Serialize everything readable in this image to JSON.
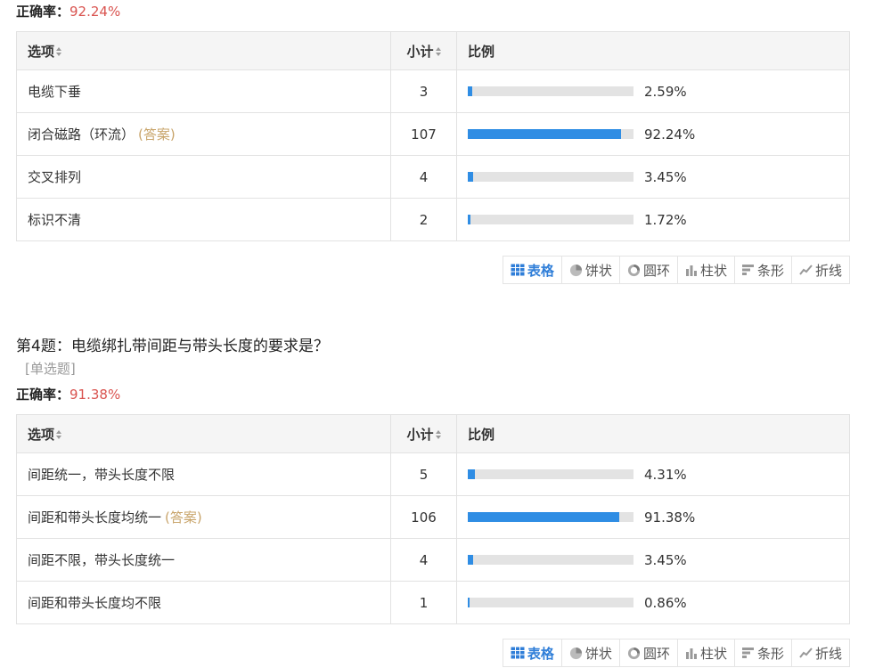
{
  "colors": {
    "accent": "#2f8de4",
    "track": "#e3e3e3",
    "accuracy": "#d9534f",
    "answer_tag": "#c8a46a"
  },
  "headers": {
    "option": "选项",
    "count": "小计",
    "ratio": "比例"
  },
  "answer_tag": "(答案)",
  "tabs": [
    {
      "label": "表格",
      "icon": "table-icon",
      "active": true
    },
    {
      "label": "饼状",
      "icon": "pie-icon",
      "active": false
    },
    {
      "label": "圆环",
      "icon": "ring-icon",
      "active": false
    },
    {
      "label": "柱状",
      "icon": "column-icon",
      "active": false
    },
    {
      "label": "条形",
      "icon": "bar-icon",
      "active": false
    },
    {
      "label": "折线",
      "icon": "line-icon",
      "active": false
    }
  ],
  "q3": {
    "accuracy_label": "正确率：",
    "accuracy_value": "92.24%",
    "rows": [
      {
        "option": "电缆下垂",
        "count": "3",
        "percent": "2.59%",
        "fraction": 0.0259,
        "is_answer": false
      },
      {
        "option": "闭合磁路（环流）",
        "count": "107",
        "percent": "92.24%",
        "fraction": 0.9224,
        "is_answer": true
      },
      {
        "option": "交叉排列",
        "count": "4",
        "percent": "3.45%",
        "fraction": 0.0345,
        "is_answer": false
      },
      {
        "option": "标识不清",
        "count": "2",
        "percent": "1.72%",
        "fraction": 0.0172,
        "is_answer": false
      }
    ]
  },
  "q4": {
    "title": "第4题：电缆绑扎带间距与带头长度的要求是？",
    "type": "[单选题]",
    "accuracy_label": "正确率：",
    "accuracy_value": "91.38%",
    "rows": [
      {
        "option": "间距统一，带头长度不限",
        "count": "5",
        "percent": "4.31%",
        "fraction": 0.0431,
        "is_answer": false
      },
      {
        "option": "间距和带头长度均统一",
        "count": "106",
        "percent": "91.38%",
        "fraction": 0.9138,
        "is_answer": true
      },
      {
        "option": "间距不限，带头长度统一",
        "count": "4",
        "percent": "3.45%",
        "fraction": 0.0345,
        "is_answer": false
      },
      {
        "option": "间距和带头长度均不限",
        "count": "1",
        "percent": "0.86%",
        "fraction": 0.0086,
        "is_answer": false
      }
    ]
  }
}
